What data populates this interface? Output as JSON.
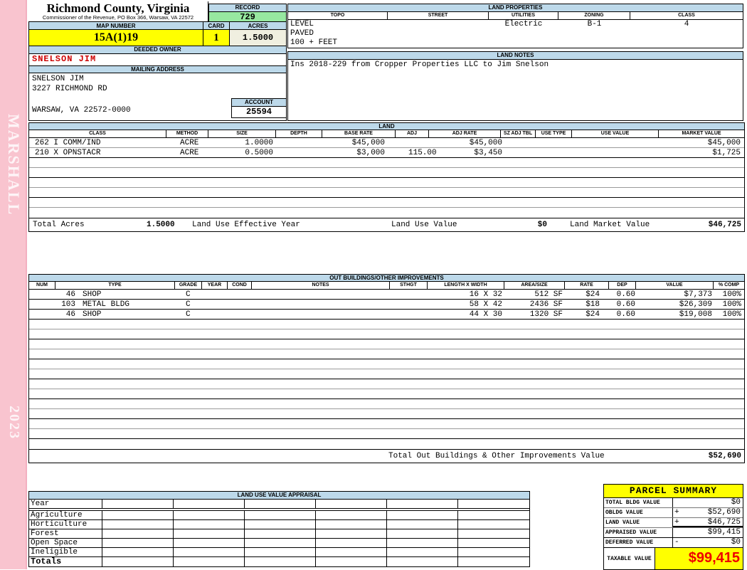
{
  "sidebar": {
    "name": "MARSHALL",
    "year": "2023"
  },
  "header": {
    "county": "Richmond County, Virginia",
    "subtitle": "Commissioner of the Revenue, PO Box 366, Warsaw, VA 22572",
    "record_label": "RECORD",
    "record_value": "729",
    "map_number_label": "MAP NUMBER",
    "map_number": "15A(1)19",
    "card_label": "CARD",
    "card": "1",
    "acres_label": "ACRES",
    "acres": "1.5000"
  },
  "land_properties": {
    "title": "LAND PROPERTIES",
    "columns": [
      "TOPO",
      "STREET",
      "UTILITIES",
      "ZONING",
      "CLASS"
    ],
    "topo_lines": [
      "LEVEL",
      "PAVED",
      "100 + FEET"
    ],
    "utilities": "Electric",
    "zoning": "B-1",
    "class": "4"
  },
  "owner": {
    "deeded_owner_label": "DEEDED OWNER",
    "deeded_owner": "SNELSON JIM",
    "mailing_address_label": "MAILING ADDRESS",
    "address_lines": [
      "SNELSON JIM",
      "3227 RICHMOND RD",
      "",
      "WARSAW, VA 22572-0000"
    ],
    "account_label": "ACCOUNT",
    "account": "25594"
  },
  "land_notes": {
    "title": "LAND NOTES",
    "note": "Ins 2018-229 from Cropper Properties LLC to Jim Snelson"
  },
  "land": {
    "title": "LAND",
    "columns": [
      "CLASS",
      "METHOD",
      "SIZE",
      "DEPTH",
      "BASE RATE",
      "ADJ",
      "ADJ RATE",
      "SZ ADJ TBL",
      "USE TYPE",
      "USE VALUE",
      "MARKET VALUE"
    ],
    "rows": [
      {
        "class": "262 I COMM/IND",
        "method": "ACRE",
        "size": "1.0000",
        "depth": "",
        "base_rate": "$45,000",
        "adj": "",
        "adj_rate": "$45,000",
        "sz_adj_tbl": "",
        "use_type": "",
        "use_value": "",
        "market_value": "$45,000"
      },
      {
        "class": "210 X OPNSTACR",
        "method": "ACRE",
        "size": "0.5000",
        "depth": "",
        "base_rate": "$3,000",
        "adj": "115.00",
        "adj_rate": "$3,450",
        "sz_adj_tbl": "",
        "use_type": "",
        "use_value": "",
        "market_value": "$1,725"
      }
    ],
    "totals": {
      "total_acres_label": "Total Acres",
      "total_acres": "1.5000",
      "effective_year_label": "Land Use Effective Year",
      "use_value_label": "Land Use Value",
      "use_value": "$0",
      "market_value_label": "Land Market Value",
      "market_value": "$46,725"
    }
  },
  "out_buildings": {
    "title": "OUT BUILDINGS/OTHER IMPROVEMENTS",
    "columns": [
      "NUM",
      "TYPE",
      "GRADE",
      "YEAR",
      "COND",
      "NOTES",
      "STHGT",
      "LENGTH X WIDTH",
      "AREA/SIZE",
      "RATE",
      "DEP",
      "VALUE",
      "% COMP"
    ],
    "rows": [
      {
        "num": "46",
        "type": "SHOP",
        "grade": "C",
        "year": "",
        "cond": "",
        "notes": "",
        "sthgt": "",
        "lxw": "16 X 32",
        "area": "512 SF",
        "rate": "$24",
        "dep": "0.60",
        "value": "$7,373",
        "comp": "100%"
      },
      {
        "num": "103",
        "type": "METAL BLDG",
        "grade": "C",
        "year": "",
        "cond": "",
        "notes": "",
        "sthgt": "",
        "lxw": "58 X 42",
        "area": "2436 SF",
        "rate": "$18",
        "dep": "0.60",
        "value": "$26,309",
        "comp": "100%"
      },
      {
        "num": "46",
        "type": "SHOP",
        "grade": "C",
        "year": "",
        "cond": "",
        "notes": "",
        "sthgt": "",
        "lxw": "44 X 30",
        "area": "1320 SF",
        "rate": "$24",
        "dep": "0.60",
        "value": "$19,008",
        "comp": "100%"
      }
    ],
    "total_label": "Total Out Buildings & Other Improvements Value",
    "total_value": "$52,690"
  },
  "land_use_appraisal": {
    "title": "LAND USE VALUE APPRAISAL",
    "row_labels": [
      "Year",
      "Agriculture",
      "Horticulture",
      "Forest",
      "Open Space",
      "Ineligible",
      "Totals"
    ]
  },
  "parcel_summary": {
    "title": "PARCEL SUMMARY",
    "rows": [
      {
        "label": "TOTAL BLDG VALUE",
        "op": "",
        "value": "$0"
      },
      {
        "label": "OBLDG VALUE",
        "op": "+",
        "value": "$52,690"
      },
      {
        "label": "LAND VALUE",
        "op": "+",
        "value": "$46,725"
      },
      {
        "label": "APPRAISED VALUE",
        "op": "",
        "value": "$99,415"
      },
      {
        "label": "DEFERRED VALUE",
        "op": "-",
        "value": "$0"
      }
    ],
    "taxable_label": "TAXABLE VALUE",
    "taxable_value": "$99,415"
  },
  "colors": {
    "header_band_blue": "#BDD9EA",
    "record_green": "#97E8A0",
    "highlight_yellow": "#FFFF00",
    "acres_cream": "#F0EFE0",
    "sidebar_pink": "#F9C4CF",
    "owner_red": "#CC0000",
    "taxable_red": "#EE0000"
  }
}
